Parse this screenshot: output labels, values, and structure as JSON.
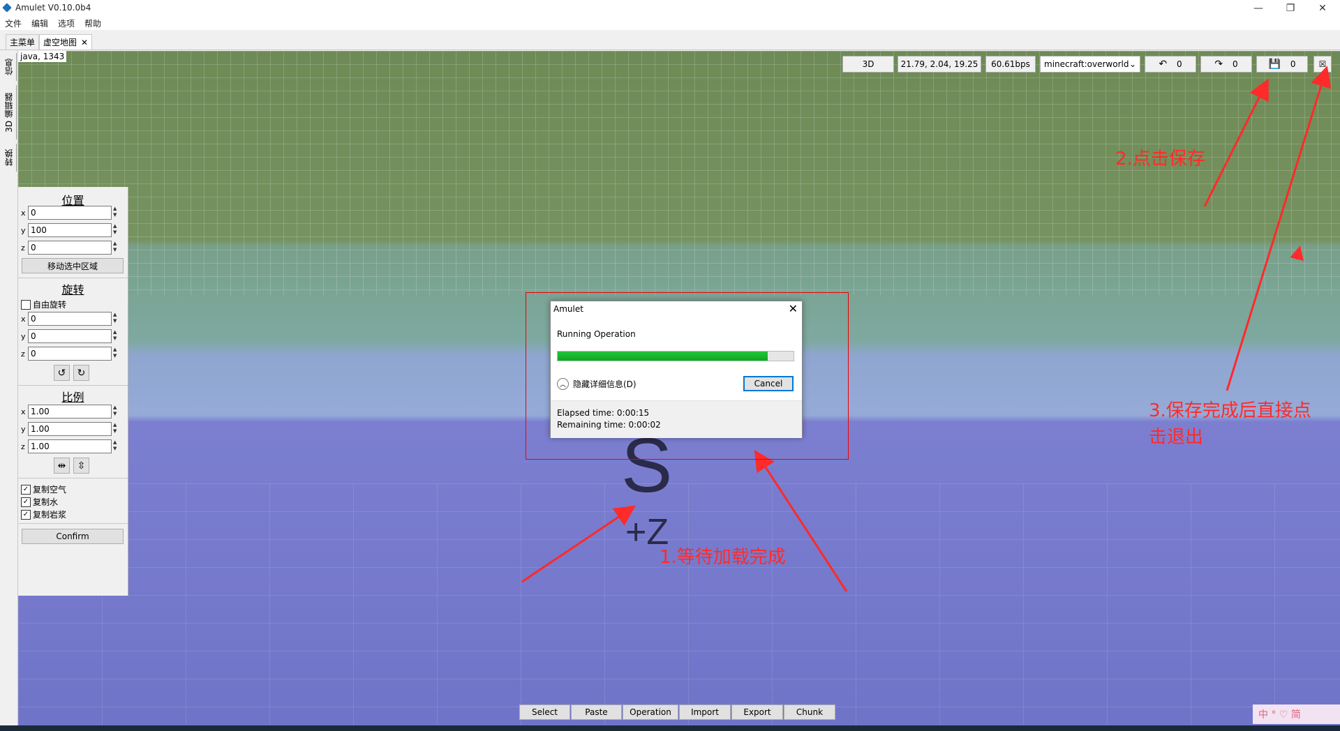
{
  "window": {
    "title": "Amulet V0.10.0b4",
    "controls": {
      "minimize": "—",
      "maximize": "❐",
      "close": "✕"
    }
  },
  "menu": [
    "文件",
    "编辑",
    "选项",
    "帮助"
  ],
  "tabs": [
    {
      "label": "主菜单",
      "closable": false
    },
    {
      "label": "虚空地图",
      "closable": true,
      "close": "✕"
    }
  ],
  "side_tabs": [
    "信息",
    "3D 编辑器",
    "转换"
  ],
  "viewport": {
    "coord_label": "java, 1343",
    "compass_letter": "S",
    "compass_axis": "+Z"
  },
  "toolbar": {
    "view_mode": "3D",
    "camera_position": "21.79, 2.04, 19.25",
    "speed": "60.61bps",
    "dimension": "minecraft:overworld",
    "undo_count": "0",
    "redo_count": "0",
    "save_count": "0",
    "icons": {
      "undo": "undo-icon",
      "redo": "redo-icon",
      "save": "save-icon",
      "close": "close-world-icon"
    }
  },
  "panel": {
    "position": {
      "title": "位置",
      "x": "0",
      "y": "100",
      "z": "0",
      "move_button": "移动选中区域"
    },
    "rotation": {
      "title": "旋转",
      "free_rotate": "自由旋转",
      "x": "0",
      "y": "0",
      "z": "0"
    },
    "scale": {
      "title": "比例",
      "x": "1.00",
      "y": "1.00",
      "z": "1.00"
    },
    "options": [
      {
        "label": "复制空气",
        "checked": true
      },
      {
        "label": "复制水",
        "checked": true
      },
      {
        "label": "复制岩浆",
        "checked": true
      }
    ],
    "confirm": "Confirm"
  },
  "bottom_bar": [
    "Select",
    "Paste",
    "Operation",
    "Import",
    "Export",
    "Chunk"
  ],
  "dialog": {
    "title": "Amulet",
    "operation": "Running Operation",
    "progress": 0.89,
    "details_toggle": "隐藏详细信息(D)",
    "cancel": "Cancel",
    "elapsed": "Elapsed time: 0:00:15",
    "remaining": "Remaining time: 0:00:02"
  },
  "annotations": {
    "step1": "1.等待加载完成",
    "step2": "2.点击保存",
    "step3_line1": "3.保存完成后直接点",
    "step3_line2": "击退出",
    "color": "#ff2a2a"
  },
  "ime": "中 ° ♡ 简"
}
